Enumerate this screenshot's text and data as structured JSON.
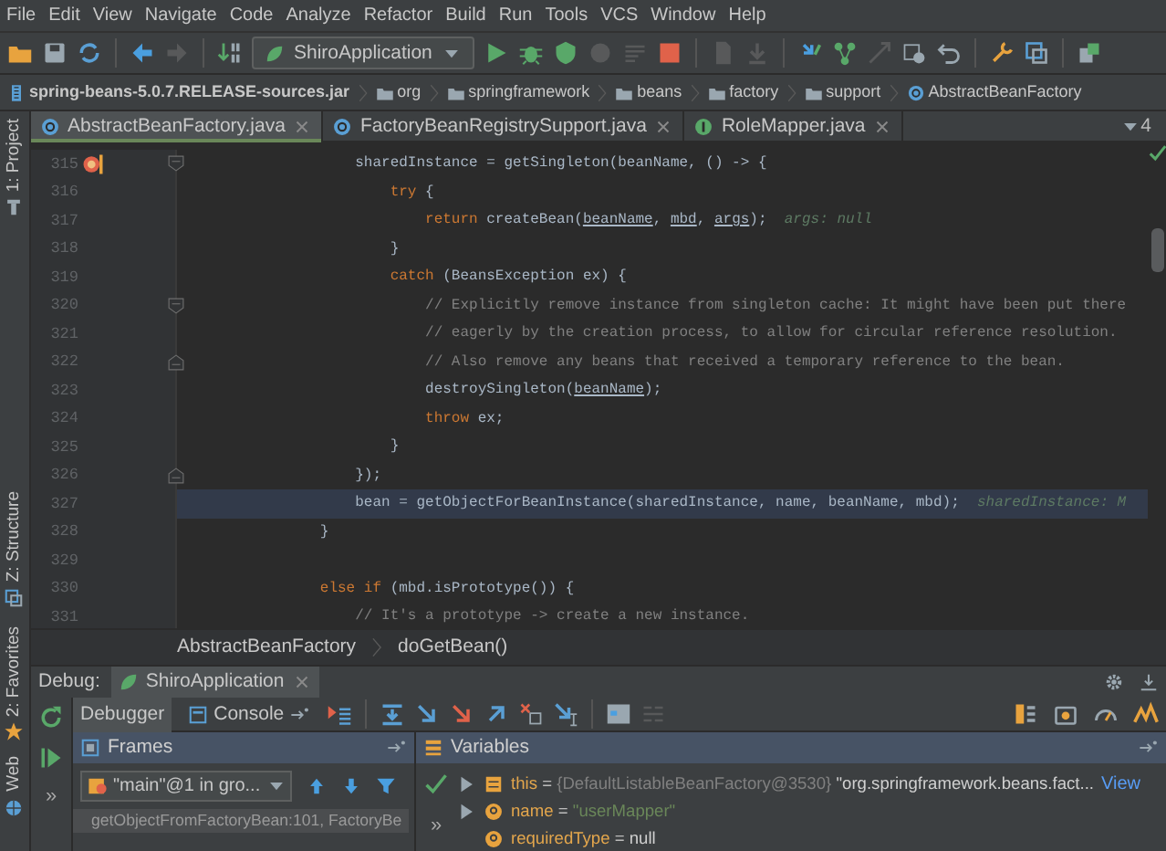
{
  "menu": [
    "File",
    "Edit",
    "View",
    "Navigate",
    "Code",
    "Analyze",
    "Refactor",
    "Build",
    "Run",
    "Tools",
    "VCS",
    "Window",
    "Help"
  ],
  "toolbar": {
    "left": [
      {
        "kind": "folder",
        "disabled": false
      },
      {
        "kind": "save",
        "disabled": false
      },
      {
        "kind": "sync",
        "disabled": false
      },
      {
        "kind": "sep"
      },
      {
        "kind": "back",
        "disabled": false
      },
      {
        "kind": "forward",
        "disabled": true
      },
      {
        "kind": "sep"
      },
      {
        "kind": "build",
        "disabled": false
      }
    ],
    "run_config": "ShiroApplication",
    "right": [
      {
        "kind": "run",
        "disabled": false
      },
      {
        "kind": "bug",
        "disabled": false
      },
      {
        "kind": "coverage",
        "disabled": false
      },
      {
        "kind": "profiler",
        "disabled": true
      },
      {
        "kind": "lines",
        "disabled": true
      },
      {
        "kind": "stop",
        "disabled": false
      },
      {
        "kind": "sep"
      },
      {
        "kind": "document",
        "disabled": true
      },
      {
        "kind": "download",
        "disabled": true
      },
      {
        "kind": "sep"
      },
      {
        "kind": "update",
        "disabled": false
      },
      {
        "kind": "branch",
        "disabled": false
      },
      {
        "kind": "arrows",
        "disabled": true
      },
      {
        "kind": "history",
        "disabled": false
      },
      {
        "kind": "undo",
        "disabled": false
      },
      {
        "kind": "sep"
      },
      {
        "kind": "wrench",
        "disabled": false
      },
      {
        "kind": "structure",
        "disabled": false
      },
      {
        "kind": "sep"
      },
      {
        "kind": "window",
        "disabled": false
      }
    ]
  },
  "nav_bar": [
    {
      "kind": "jar",
      "label": "spring-beans-5.0.7.RELEASE-sources.jar"
    },
    {
      "kind": "package",
      "label": "org"
    },
    {
      "kind": "package",
      "label": "springframework"
    },
    {
      "kind": "package",
      "label": "beans"
    },
    {
      "kind": "package",
      "label": "factory"
    },
    {
      "kind": "package",
      "label": "support"
    },
    {
      "kind": "class",
      "label": "AbstractBeanFactory"
    }
  ],
  "side_tools": [
    {
      "kind": "project",
      "label": "1: Project"
    },
    {
      "kind": "structure",
      "label": "Z: Structure"
    },
    {
      "kind": "favorites",
      "label": "2: Favorites"
    },
    {
      "kind": "web",
      "label": "Web"
    }
  ],
  "tabs": [
    {
      "kind": "class",
      "label": "AbstractBeanFactory.java",
      "selected": true
    },
    {
      "kind": "class",
      "label": "FactoryBeanRegistrySupport.java",
      "selected": false
    },
    {
      "kind": "interface",
      "label": "RoleMapper.java",
      "selected": false
    }
  ],
  "tabs_overflow": "4",
  "editor": {
    "lines": [
      {
        "number": "315",
        "breakpoint": true,
        "fold_start": true,
        "current": false,
        "tokens": [
          {
            "text": "            sharedInstance = getSingleton(beanName, () -> {",
            "kind": "plain"
          }
        ]
      },
      {
        "number": "316",
        "breakpoint": false,
        "current": false,
        "tokens": [
          {
            "text": "                try",
            "kind": "keyword"
          },
          {
            "text": " {",
            "kind": "plain"
          }
        ]
      },
      {
        "number": "317",
        "breakpoint": false,
        "current": false,
        "tokens": [
          {
            "text": "                    return",
            "kind": "keyword"
          },
          {
            "text": " createBean(",
            "kind": "plain"
          },
          {
            "text": "beanName",
            "kind": "param"
          },
          {
            "text": ", ",
            "kind": "plain"
          },
          {
            "text": "mbd",
            "kind": "param"
          },
          {
            "text": ", ",
            "kind": "plain"
          },
          {
            "text": "args",
            "kind": "param"
          },
          {
            "text": ");",
            "kind": "plain"
          },
          {
            "text": "  args: null",
            "kind": "hint"
          }
        ]
      },
      {
        "number": "318",
        "breakpoint": false,
        "current": false,
        "tokens": [
          {
            "text": "                }",
            "kind": "plain"
          }
        ]
      },
      {
        "number": "319",
        "breakpoint": false,
        "current": false,
        "tokens": [
          {
            "text": "                catch",
            "kind": "keyword"
          },
          {
            "text": " (BeansException ex) {",
            "kind": "plain"
          }
        ]
      },
      {
        "number": "320",
        "breakpoint": false,
        "fold_start": true,
        "current": false,
        "tokens": [
          {
            "text": "                    // Explicitly remove instance from singleton cache: It might have been put there",
            "kind": "comment"
          }
        ]
      },
      {
        "number": "321",
        "breakpoint": false,
        "current": false,
        "tokens": [
          {
            "text": "                    // eagerly by the creation process, to allow for circular reference resolution.",
            "kind": "comment"
          }
        ]
      },
      {
        "number": "322",
        "breakpoint": false,
        "fold_end": true,
        "current": false,
        "tokens": [
          {
            "text": "                    // Also remove any beans that received a temporary reference to the bean.",
            "kind": "comment"
          }
        ]
      },
      {
        "number": "323",
        "breakpoint": false,
        "current": false,
        "tokens": [
          {
            "text": "                    destroySingleton(",
            "kind": "plain"
          },
          {
            "text": "beanName",
            "kind": "param"
          },
          {
            "text": ");",
            "kind": "plain"
          }
        ]
      },
      {
        "number": "324",
        "breakpoint": false,
        "current": false,
        "tokens": [
          {
            "text": "                    throw",
            "kind": "keyword"
          },
          {
            "text": " ex;",
            "kind": "plain"
          }
        ]
      },
      {
        "number": "325",
        "breakpoint": false,
        "current": false,
        "tokens": [
          {
            "text": "                }",
            "kind": "plain"
          }
        ]
      },
      {
        "number": "326",
        "breakpoint": false,
        "fold_end": true,
        "current": false,
        "tokens": [
          {
            "text": "            });",
            "kind": "plain"
          }
        ]
      },
      {
        "number": "327",
        "breakpoint": false,
        "current": true,
        "tokens": [
          {
            "text": "            bean = getObjectForBeanInstance(sharedInstance, name, beanName, mbd);",
            "kind": "plain"
          },
          {
            "text": "  sharedInstance: M",
            "kind": "hint"
          }
        ]
      },
      {
        "number": "328",
        "breakpoint": false,
        "current": false,
        "tokens": [
          {
            "text": "        }",
            "kind": "plain"
          }
        ]
      },
      {
        "number": "329",
        "breakpoint": false,
        "current": false
      },
      {
        "number": "330",
        "breakpoint": false,
        "current": false,
        "tokens": [
          {
            "text": "        else if",
            "kind": "keyword"
          },
          {
            "text": " (mbd.isPrototype()) {",
            "kind": "plain"
          }
        ]
      },
      {
        "number": "331",
        "breakpoint": false,
        "current": false,
        "tokens": [
          {
            "text": "            // It's a prototype -> create a new instance.",
            "kind": "comment"
          }
        ]
      }
    ]
  },
  "editor_breadcrumb": [
    "AbstractBeanFactory",
    "doGetBean()"
  ],
  "debug": {
    "label": "Debug:",
    "session": "ShiroApplication",
    "side_buttons": [
      {
        "kind": "rerun"
      },
      {
        "kind": "resume"
      }
    ],
    "side_more": "»",
    "tabs": [
      {
        "kind": "debugger",
        "label": "Debugger",
        "selected": true
      },
      {
        "kind": "console",
        "label": "Console",
        "selected": false
      }
    ],
    "step_buttons": [
      {
        "kind": "execpoint",
        "disabled": false
      },
      {
        "kind": "sep"
      },
      {
        "kind": "stepover",
        "disabled": false
      },
      {
        "kind": "stepinto",
        "disabled": false
      },
      {
        "kind": "forcestep",
        "disabled": false
      },
      {
        "kind": "stepout",
        "disabled": false
      },
      {
        "kind": "dropframe",
        "disabled": false
      },
      {
        "kind": "runcursor",
        "disabled": false
      },
      {
        "kind": "sep"
      },
      {
        "kind": "evaluate",
        "disabled": false
      },
      {
        "kind": "trace",
        "disabled": true
      }
    ],
    "right_buttons": [
      {
        "kind": "layout"
      },
      {
        "kind": "camera"
      },
      {
        "kind": "gauge"
      },
      {
        "kind": "pulse"
      }
    ],
    "frames": {
      "title": "Frames",
      "thread": "\"main\"@1 in gro...",
      "items": [
        {
          "label": "getObjectFromFactoryBean:101, FactoryBe",
          "selected": true
        }
      ]
    },
    "variables": {
      "title": "Variables",
      "more": "»",
      "items": [
        {
          "kind": "object",
          "name": "this",
          "operator": "=",
          "color": "#808080",
          "value": "{DefaultListableBeanFactory@3530}",
          "detail": "\"org.springframework.beans.fact...",
          "link": "View",
          "expandable": true
        },
        {
          "kind": "param",
          "name": "name",
          "operator": "=",
          "color": "#6a8759",
          "value": "\"userMapper\"",
          "expandable": true
        },
        {
          "kind": "param",
          "name": "requiredType",
          "operator": "=",
          "color": "#d0d0d0",
          "value": "null",
          "expandable": false
        }
      ]
    }
  }
}
